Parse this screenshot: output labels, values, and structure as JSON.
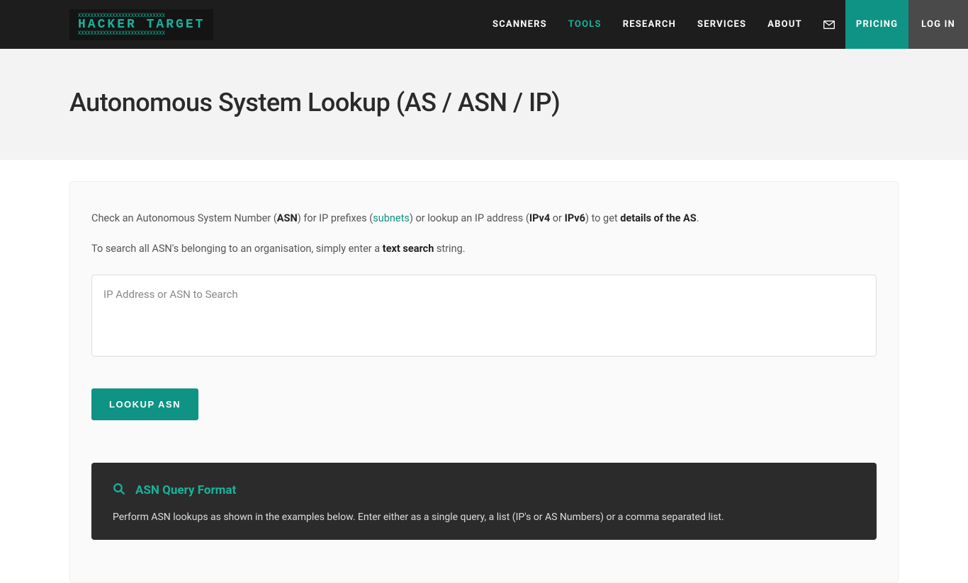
{
  "brand": "HACKER TARGET",
  "nav": {
    "scanners": "SCANNERS",
    "tools": "TOOLS",
    "research": "RESEARCH",
    "services": "SERVICES",
    "about": "ABOUT",
    "pricing": "PRICING",
    "login": "LOG IN"
  },
  "page": {
    "title": "Autonomous System Lookup (AS / ASN / IP)"
  },
  "intro": {
    "p1_a": "Check an Autonomous System Number (",
    "p1_asn": "ASN",
    "p1_b": ") for IP prefixes (",
    "p1_subnets": "subnets",
    "p1_c": ") or lookup an IP address (",
    "p1_ipv4": "IPv4",
    "p1_or": " or ",
    "p1_ipv6": "IPv6",
    "p1_d": ") to get ",
    "p1_details": "details of the AS",
    "p1_e": ".",
    "p2_a": "To search all ASN's belonging to an organisation, simply enter a ",
    "p2_ts": "text search",
    "p2_b": " string."
  },
  "search": {
    "placeholder": "IP Address or ASN to Search",
    "button": "LOOKUP ASN"
  },
  "panel": {
    "heading": "ASN Query Format",
    "body": "Perform ASN lookups as shown in the examples below. Enter either as a single query, a list (IP's or AS Numbers) or a comma separated list."
  }
}
